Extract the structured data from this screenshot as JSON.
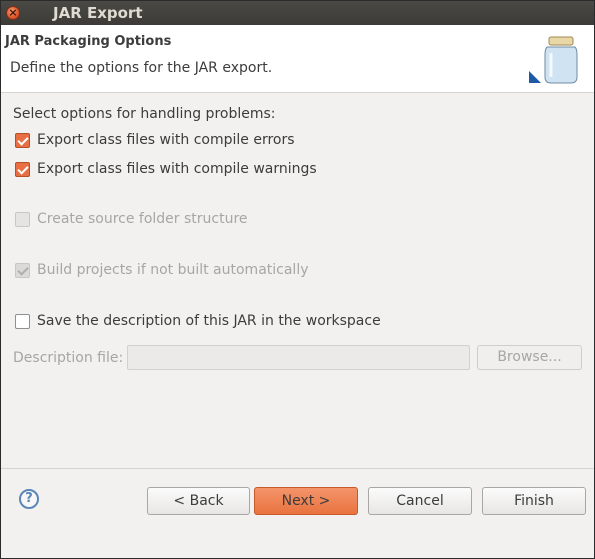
{
  "window": {
    "title": "JAR Export",
    "close_glyph": "×"
  },
  "banner": {
    "title": "JAR Packaging Options",
    "description": "Define the options for the JAR export.",
    "icon": "jar-icon"
  },
  "options": {
    "section_label": "Select options for handling problems:",
    "export_errors": {
      "label": "Export class files with compile errors",
      "checked": true,
      "enabled": true
    },
    "export_warnings": {
      "label": "Export class files with compile warnings",
      "checked": true,
      "enabled": true
    },
    "create_source_folder": {
      "label": "Create source folder structure",
      "checked": false,
      "enabled": false
    },
    "build_projects": {
      "label": "Build projects if not built automatically",
      "checked": true,
      "enabled": false
    },
    "save_description": {
      "label": "Save the description of this JAR in the workspace",
      "checked": false,
      "enabled": true
    }
  },
  "description_file": {
    "label": "Description file:",
    "value": "",
    "browse_label": "Browse..."
  },
  "footer": {
    "help_glyph": "?",
    "back_label": "< Back",
    "next_label": "Next >",
    "cancel_label": "Cancel",
    "finish_label": "Finish"
  },
  "colors": {
    "accent": "#e9733f",
    "checkbox_checked": "#e86f44",
    "titlebar": "#3c3b37"
  }
}
